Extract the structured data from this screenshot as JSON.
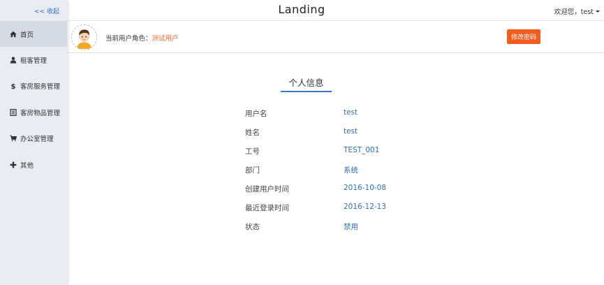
{
  "header": {
    "brand": "Landing",
    "welcome": "欢迎您，test"
  },
  "sidebar": {
    "collapse_label": "<< 收起",
    "items": [
      {
        "label": "首页",
        "icon": "home-icon"
      },
      {
        "label": "租客管理",
        "icon": "user-icon"
      },
      {
        "label": "客房服务管理",
        "icon": "dollar-icon"
      },
      {
        "label": "客房物品管理",
        "icon": "list-icon"
      },
      {
        "label": "办公室管理",
        "icon": "cart-icon"
      },
      {
        "label": "其他",
        "icon": "plus-icon"
      }
    ],
    "active_index": 0
  },
  "rolebar": {
    "role_label": "当前用户角色：",
    "role_value": "测试用户",
    "change_password_label": "修改密码"
  },
  "profile": {
    "title": "个人信息",
    "fields": [
      {
        "label": "用户名",
        "value": "test"
      },
      {
        "label": "姓名",
        "value": "test"
      },
      {
        "label": "工号",
        "value": "TEST_001"
      },
      {
        "label": "部门",
        "value": "系统"
      },
      {
        "label": "创建用户时间",
        "value": "2016-10-08"
      },
      {
        "label": "最近登录时间",
        "value": "2016-12-13"
      },
      {
        "label": "状态",
        "value": "禁用"
      }
    ]
  },
  "colors": {
    "accent": "#3a78c4",
    "button": "#f45d1e",
    "role_value": "#f0642a",
    "sidebar_bg": "#e9ecf3"
  }
}
